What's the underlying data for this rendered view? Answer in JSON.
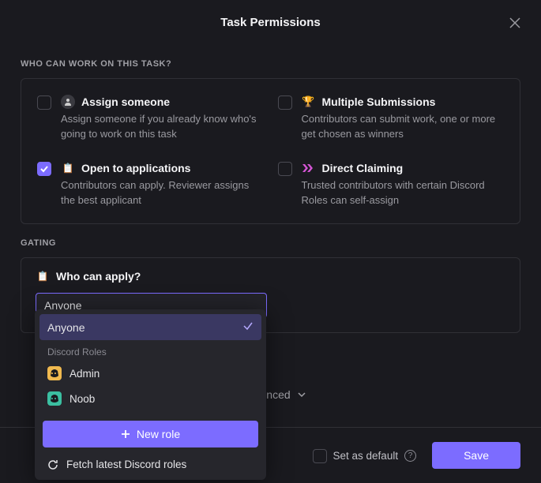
{
  "modal": {
    "title": "Task Permissions",
    "sections": {
      "work": {
        "label": "WHO CAN WORK ON THIS TASK?",
        "options": {
          "assign": {
            "title": "Assign someone",
            "desc": "Assign someone if you already know who's going to work on this task",
            "checked": false
          },
          "multiple": {
            "title": "Multiple Submissions",
            "desc": "Contributors can submit work, one or more get chosen as winners",
            "checked": false
          },
          "open": {
            "title": "Open to applications",
            "desc": "Contributors can apply. Reviewer assigns the best applicant",
            "checked": true
          },
          "direct": {
            "title": "Direct Claiming",
            "desc": "Trusted contributors with certain Discord Roles can self-assign",
            "checked": false
          }
        }
      },
      "gating": {
        "label": "GATING",
        "title": "Who can apply?",
        "input_value": "Anyone",
        "dropdown": {
          "selected": "Anyone",
          "group_label": "Discord Roles",
          "roles": [
            {
              "name": "Admin",
              "badge_bg": "#f0b94f"
            },
            {
              "name": "Noob",
              "badge_bg": "#3bbfa1"
            }
          ],
          "new_role": "New role",
          "fetch": "Fetch latest Discord roles"
        }
      }
    },
    "advanced_label": "Advanced",
    "footer": {
      "default_label": "Set as default",
      "save_label": "Save"
    }
  }
}
